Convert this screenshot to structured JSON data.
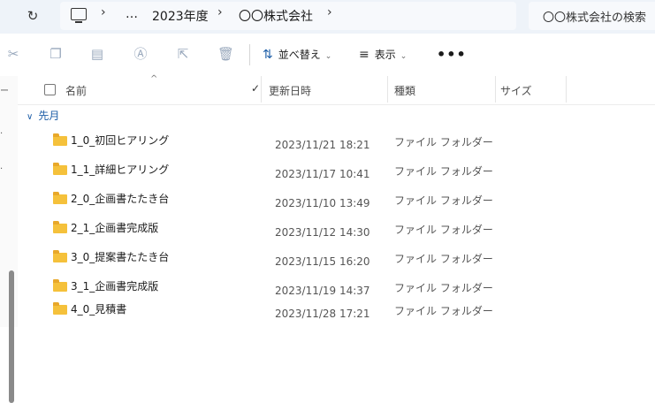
{
  "address_bar": {
    "refresh_icon": "refresh-icon",
    "breadcrumbs": [
      "…",
      "2023年度",
      "〇〇株式会社"
    ],
    "search_placeholder": "〇〇株式会社の検索"
  },
  "toolbar": {
    "cut_icon": "scissors-icon",
    "copy_icon": "copy-icon",
    "paste_icon": "paste-icon",
    "rename_icon": "rename-icon",
    "share_icon": "share-icon",
    "delete_icon": "trash-icon",
    "sort_label": "並べ替え",
    "view_label": "表示",
    "more_label": "•••"
  },
  "columns": {
    "name": "名前",
    "modified": "更新日時",
    "type": "種類",
    "size": "サイズ"
  },
  "group": {
    "label": "先月"
  },
  "files": [
    {
      "name": "1_0_初回ヒアリング",
      "modified": "2023/11/21 18:21",
      "type": "ファイル フォルダー"
    },
    {
      "name": "1_1_詳細ヒアリング",
      "modified": "2023/11/17 10:41",
      "type": "ファイル フォルダー"
    },
    {
      "name": "2_0_企画書たたき台",
      "modified": "2023/11/10 13:49",
      "type": "ファイル フォルダー"
    },
    {
      "name": "2_1_企画書完成版",
      "modified": "2023/11/12 14:30",
      "type": "ファイル フォルダー"
    },
    {
      "name": "3_0_提案書たたき台",
      "modified": "2023/11/15 16:20",
      "type": "ファイル フォルダー"
    },
    {
      "name": "3_1_企画書完成版",
      "modified": "2023/11/19 14:37",
      "type": "ファイル フォルダー"
    },
    {
      "name": "4_0_見積書",
      "modified": "2023/11/28 17:21",
      "type": "ファイル フォルダー"
    }
  ]
}
